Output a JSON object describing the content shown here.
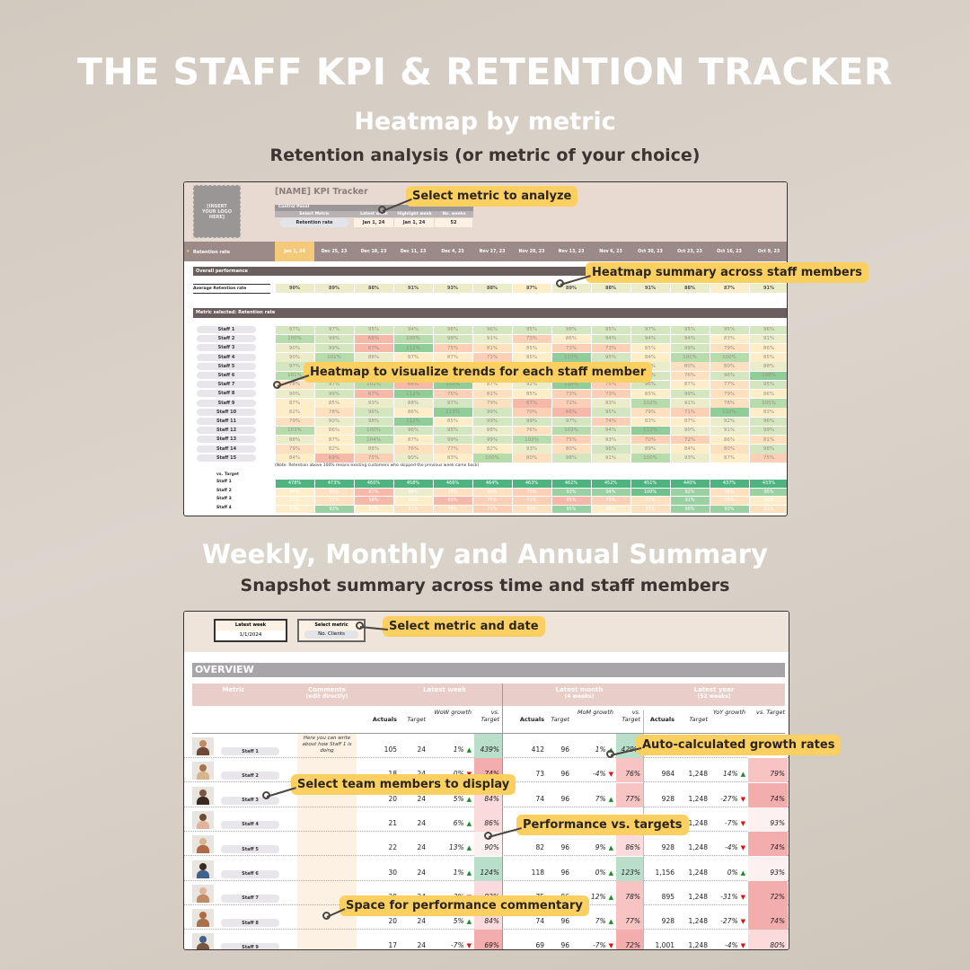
{
  "title": "THE STAFF KPI & RETENTION TRACKER",
  "section1": {
    "title": "Heatmap by metric",
    "subtitle": "Retention analysis (or metric of your choice)"
  },
  "section2": {
    "title": "Weekly, Monthly and Annual Summary",
    "subtitle": "Snapshot summary across time and staff members"
  },
  "heatmap_sheet": {
    "logo_placeholder": "[INSERT YOUR LOGO HERE]",
    "sheet_title": "[NAME] KPI Tracker",
    "control_panel": {
      "label": "Control Panel",
      "headers": [
        "Select Metric",
        "Latest week",
        "Highlight week",
        "No. weeks"
      ],
      "values": [
        "Retention rate",
        "Jan 1, 24",
        "Jan 1, 24",
        "52"
      ]
    },
    "metric_label": "Retention rate",
    "dates": [
      "Jan 1, 24",
      "Dec 25, 23",
      "Dec 18, 23",
      "Dec 11, 23",
      "Dec 4, 23",
      "Nov 27, 23",
      "Nov 20, 23",
      "Nov 13, 23",
      "Nov 6, 23",
      "Oct 30, 23",
      "Oct 23, 23",
      "Oct 16, 23",
      "Oct 9, 23"
    ],
    "overall_label": "Overall performance",
    "average_label": "Average Retention rate",
    "average": [
      90,
      89,
      88,
      91,
      93,
      88,
      87,
      89,
      88,
      91,
      88,
      87,
      91
    ],
    "metric_selected_label": "Metric selected: Retention rate",
    "staff": [
      "Staff 1",
      "Staff 2",
      "Staff 3",
      "Staff 4",
      "Staff 5",
      "Staff 6",
      "Staff 7",
      "Staff 8",
      "Staff 9",
      "Staff 10",
      "Staff 11",
      "Staff 12",
      "Staff 13",
      "Staff 14",
      "Staff 15"
    ],
    "values": [
      [
        97,
        97,
        95,
        94,
        96,
        96,
        95,
        98,
        95,
        97,
        95,
        95,
        96
      ],
      [
        100,
        99,
        68,
        100,
        98,
        91,
        73,
        86,
        94,
        94,
        94,
        83,
        91
      ],
      [
        90,
        99,
        67,
        112,
        75,
        81,
        85,
        73,
        73,
        85,
        99,
        79,
        86
      ],
      [
        90,
        101,
        88,
        87,
        87,
        71,
        85,
        110,
        95,
        84,
        101,
        100,
        85
      ],
      [
        97,
        null,
        null,
        null,
        null,
        null,
        null,
        null,
        null,
        93,
        80,
        80,
        88
      ],
      [
        101,
        null,
        null,
        null,
        null,
        null,
        null,
        null,
        null,
        95,
        76,
        96,
        108
      ],
      [
        78,
        97,
        102,
        66,
        115,
        87,
        92,
        110,
        75,
        96,
        87,
        77,
        95
      ],
      [
        90,
        99,
        67,
        112,
        75,
        81,
        85,
        73,
        73,
        85,
        99,
        79,
        86
      ],
      [
        87,
        85,
        93,
        88,
        97,
        79,
        67,
        72,
        93,
        102,
        91,
        78,
        105
      ],
      [
        82,
        78,
        96,
        86,
        113,
        99,
        70,
        66,
        95,
        79,
        71,
        110,
        83
      ],
      [
        79,
        90,
        98,
        112,
        85,
        99,
        99,
        97,
        74,
        83,
        87,
        92,
        96
      ],
      [
        103,
        86,
        100,
        96,
        95,
        88,
        76,
        102,
        94,
        112,
        90,
        91,
        99
      ],
      [
        88,
        87,
        104,
        87,
        99,
        99,
        102,
        75,
        93,
        70,
        72,
        86,
        81
      ],
      [
        79,
        82,
        88,
        76,
        77,
        82,
        93,
        80,
        96,
        89,
        84,
        80,
        98
      ],
      [
        84,
        69,
        75,
        90,
        83,
        100,
        80,
        98,
        91,
        100,
        93,
        87,
        75
      ]
    ],
    "note": "(Note: Retention above 100% means existing customers who skipped the previous week came back)",
    "vs_target_label": "vs. Target",
    "vs_target": [
      {
        "staff": "Staff 1",
        "values": [
          478,
          473,
          460,
          458,
          466,
          464,
          463,
          462,
          452,
          451,
          440,
          437,
          433
        ]
      },
      {
        "staff": "Staff 2",
        "values": [
          84,
          80,
          67,
          88,
          78,
          80,
          75,
          93,
          94,
          100,
          92,
          76,
          95
        ]
      },
      {
        "staff": "Staff 3",
        "values": [
          82,
          77,
          58,
          83,
          63,
          75,
          72,
          65,
          75,
          77,
          91,
          76,
          85
        ]
      },
      {
        "staff": "Staff 4",
        "values": [
          83,
          93,
          87,
          81,
          78,
          71,
          80,
          95,
          86,
          81,
          96,
          93,
          81
        ]
      }
    ]
  },
  "summary_sheet": {
    "latest_week": {
      "label": "Latest week",
      "value": "1/1/2024"
    },
    "select_metric": {
      "label": "Select metric",
      "value": "No. Clients"
    },
    "overview_label": "OVERVIEW",
    "groups": {
      "metric": "Metric",
      "comments": "Comments",
      "comments_sub": "(edit directly)",
      "week": "Latest week",
      "month": "Latest month",
      "month_sub": "(4 weeks)",
      "year": "Latest year",
      "year_sub": "(52 weeks)"
    },
    "subheaders": {
      "actuals": "Actuals",
      "target": "Target",
      "wow": "WoW growth",
      "mom": "MoM growth",
      "yoy": "YoY growth",
      "vs": "vs. Target"
    },
    "comment_example": "Here you can write about how Staff 1 is doing",
    "rows": [
      {
        "name": "Staff 1",
        "w": [
          "105",
          "24",
          "1%",
          "up",
          "439%"
        ],
        "m": [
          "412",
          "96",
          "1%",
          "up",
          "429%"
        ],
        "y": [
          "",
          "",
          "",
          "",
          ""
        ]
      },
      {
        "name": "Staff 2",
        "w": [
          "18",
          "24",
          "0%",
          "down",
          "74%"
        ],
        "m": [
          "73",
          "96",
          "-4%",
          "down",
          "76%"
        ],
        "y": [
          "984",
          "1,248",
          "14%",
          "up",
          "79%"
        ]
      },
      {
        "name": "Staff 3",
        "w": [
          "20",
          "24",
          "5%",
          "up",
          "84%"
        ],
        "m": [
          "74",
          "96",
          "7%",
          "up",
          "77%"
        ],
        "y": [
          "928",
          "1,248",
          "-27%",
          "down",
          "74%"
        ]
      },
      {
        "name": "Staff 4",
        "w": [
          "21",
          "24",
          "6%",
          "up",
          "86%"
        ],
        "m": [
          "",
          "",
          "",
          "",
          ""
        ],
        "y": [
          "",
          "1,248",
          "-7%",
          "down",
          "93%"
        ]
      },
      {
        "name": "Staff 5",
        "w": [
          "22",
          "24",
          "13%",
          "up",
          "90%"
        ],
        "m": [
          "82",
          "96",
          "9%",
          "up",
          "86%"
        ],
        "y": [
          "928",
          "1,248",
          "-4%",
          "down",
          "74%"
        ]
      },
      {
        "name": "Staff 6",
        "w": [
          "30",
          "24",
          "1%",
          "up",
          "124%"
        ],
        "m": [
          "118",
          "96",
          "0%",
          "up",
          "123%"
        ],
        "y": [
          "1,156",
          "1,248",
          "0%",
          "up",
          "93%"
        ]
      },
      {
        "name": "Staff 7",
        "w": [
          "20",
          "24",
          "-3%",
          "down",
          "83%"
        ],
        "m": [
          "75",
          "96",
          "12%",
          "up",
          "78%"
        ],
        "y": [
          "895",
          "1,248",
          "-31%",
          "down",
          "72%"
        ]
      },
      {
        "name": "Staff 8",
        "w": [
          "20",
          "24",
          "5%",
          "up",
          "84%"
        ],
        "m": [
          "74",
          "96",
          "7%",
          "up",
          "77%"
        ],
        "y": [
          "928",
          "1,248",
          "-27%",
          "down",
          "74%"
        ]
      },
      {
        "name": "Staff 9",
        "w": [
          "17",
          "24",
          "-7%",
          "down",
          "69%"
        ],
        "m": [
          "69",
          "96",
          "-7%",
          "down",
          "72%"
        ],
        "y": [
          "1,001",
          "1,248",
          "-4%",
          "down",
          "80%"
        ]
      }
    ]
  },
  "callouts": {
    "c1": "Select metric to analyze",
    "c2": "Heatmap summary across staff members",
    "c3": "Heatmap to visualize trends for each staff member",
    "c4": "Select metric and date",
    "c5": "Auto-calculated growth rates",
    "c6": "Select team members to display",
    "c7": "Performance vs. targets",
    "c8": "Space for performance commentary"
  },
  "colors": {
    "callout": "#fcd060",
    "date_bar": "#9b8a87",
    "highlight": "#f5c97a",
    "dark_bar": "#6b5e5e",
    "up": "#1e8a2a",
    "down": "#e01010"
  }
}
